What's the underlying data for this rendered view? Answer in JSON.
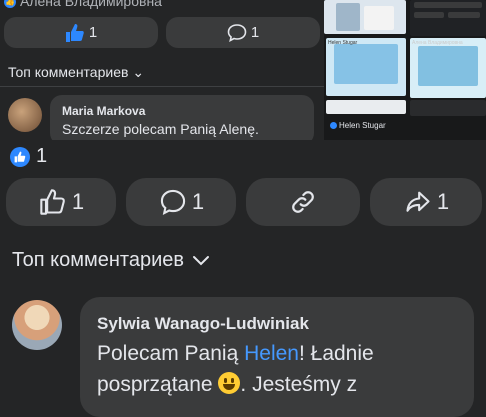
{
  "embed": {
    "author": "Алена Владимировна",
    "like_count": "1",
    "comment_count": "1",
    "top_comments_label": "Топ комментариев",
    "comment": {
      "name": "Maria Markova",
      "text": "Szczerze polecam Panią Alenę."
    }
  },
  "thumb": {
    "helen_label": "Helen Stugar",
    "snippet1": "Алена Владимировна",
    "snippet2": "Helen Stugar"
  },
  "post": {
    "reaction_count": "1",
    "like_count": "1",
    "comment_count": "1",
    "share_count": "1",
    "top_comments_label": "Топ комментариев"
  },
  "comment": {
    "author": "Sylwia Wanago-Ludwiniak",
    "text_before": "Polecam Panią ",
    "mention": "Helen",
    "text_after": "! Ładnie",
    "line2_before": "posprzątane ",
    "line2_after": ". Jesteśmy z"
  },
  "colors": {
    "background": "#242526",
    "pill": "#3a3b3c",
    "accent": "#2d88ff",
    "mention": "#4599ff"
  }
}
